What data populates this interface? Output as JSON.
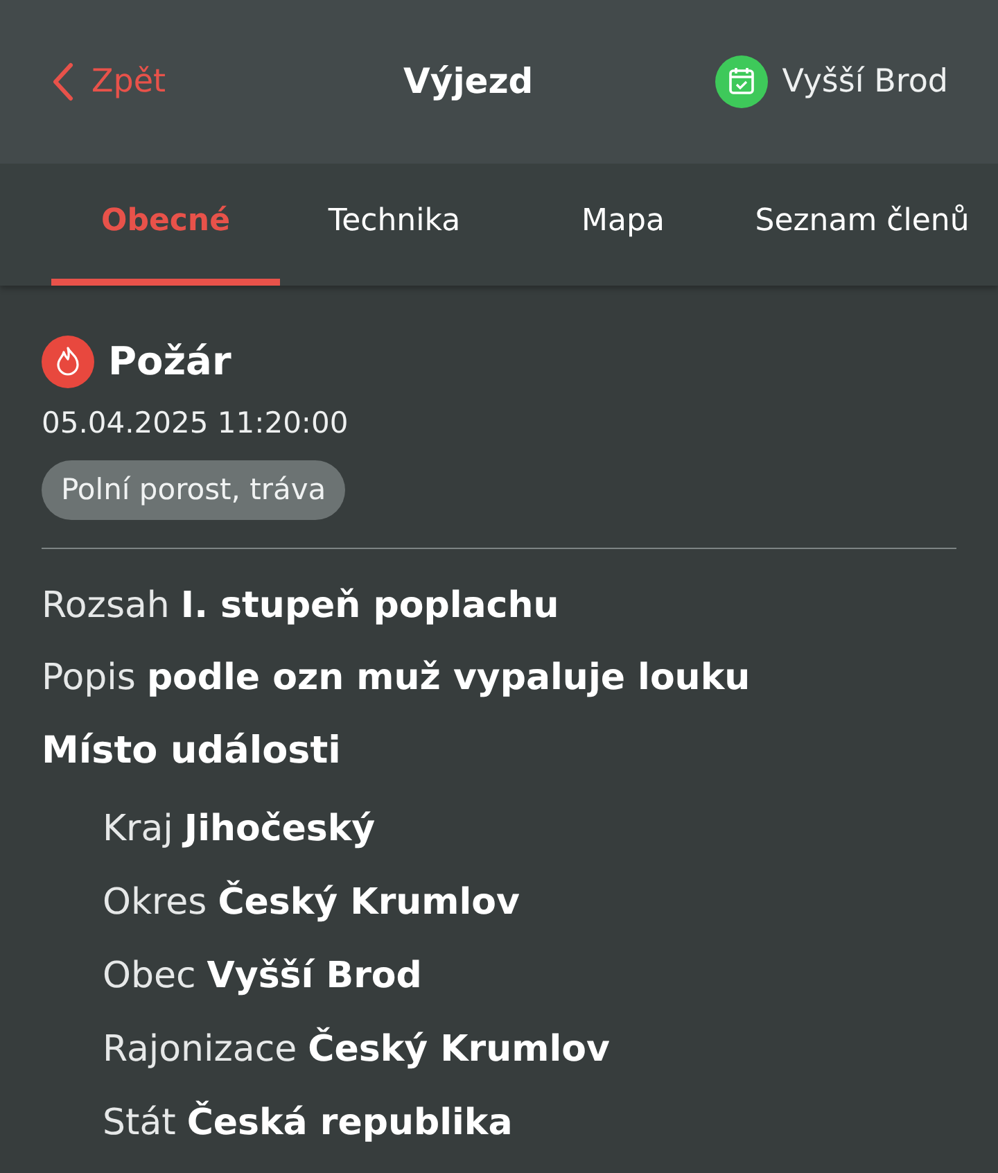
{
  "header": {
    "back": "Zpět",
    "title": "Výjezd",
    "unit": "Vyšší Brod"
  },
  "tabs": [
    {
      "label": "Obecné",
      "selected": true
    },
    {
      "label": "Technika",
      "selected": false
    },
    {
      "label": "Mapa",
      "selected": false
    },
    {
      "label": "Seznam členů",
      "selected": false
    }
  ],
  "event": {
    "type": "Požár",
    "datetime": "05.04.2025 11:20:00",
    "tag": "Polní porost, tráva"
  },
  "details": [
    {
      "label": "Rozsah",
      "value": "I. stupeň poplachu"
    },
    {
      "label": "Popis",
      "value": "podle ozn muž vypaluje louku"
    }
  ],
  "location": {
    "title": "Místo události",
    "fields": [
      {
        "label": "Kraj",
        "value": "Jihočeský"
      },
      {
        "label": "Okres",
        "value": "Český Krumlov"
      },
      {
        "label": "Obec",
        "value": "Vyšší Brod"
      },
      {
        "label": "Rajonizace",
        "value": "Český Krumlov"
      },
      {
        "label": "Stát",
        "value": "Česká republika"
      }
    ]
  }
}
